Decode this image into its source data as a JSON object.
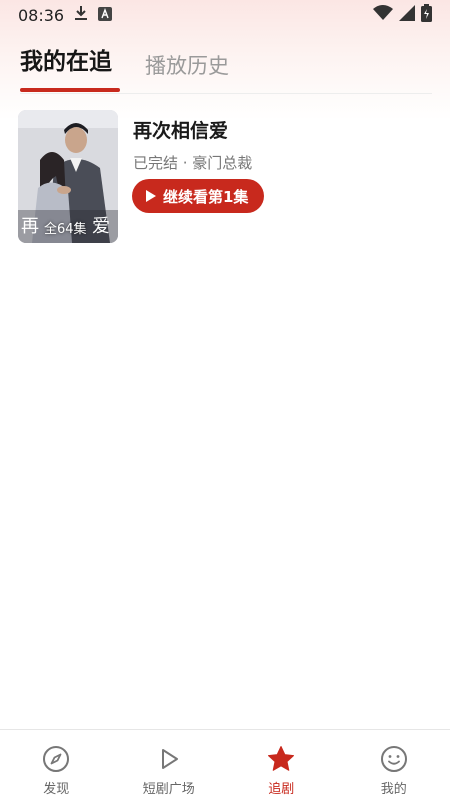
{
  "status_bar": {
    "time": "08:36",
    "icons": [
      "download-icon",
      "a-notification-icon",
      "wifi-icon",
      "signal-icon",
      "battery-icon"
    ]
  },
  "tabs": [
    {
      "label": "我的在追",
      "active": true
    },
    {
      "label": "播放历史",
      "active": false
    }
  ],
  "drama": {
    "title": "再次相信爱",
    "meta": "已完结 · 豪门总裁",
    "badge": "全64集",
    "continue_label": "继续看第1集"
  },
  "bottom_nav": [
    {
      "label": "发现",
      "icon": "compass-icon",
      "active": false
    },
    {
      "label": "短剧广场",
      "icon": "play-outline-icon",
      "active": false
    },
    {
      "label": "追剧",
      "icon": "star-icon",
      "active": true
    },
    {
      "label": "我的",
      "icon": "smile-icon",
      "active": false
    }
  ],
  "colors": {
    "accent": "#c8291d",
    "inactive_text": "#9a9a9a",
    "nav_text": "#666666"
  }
}
